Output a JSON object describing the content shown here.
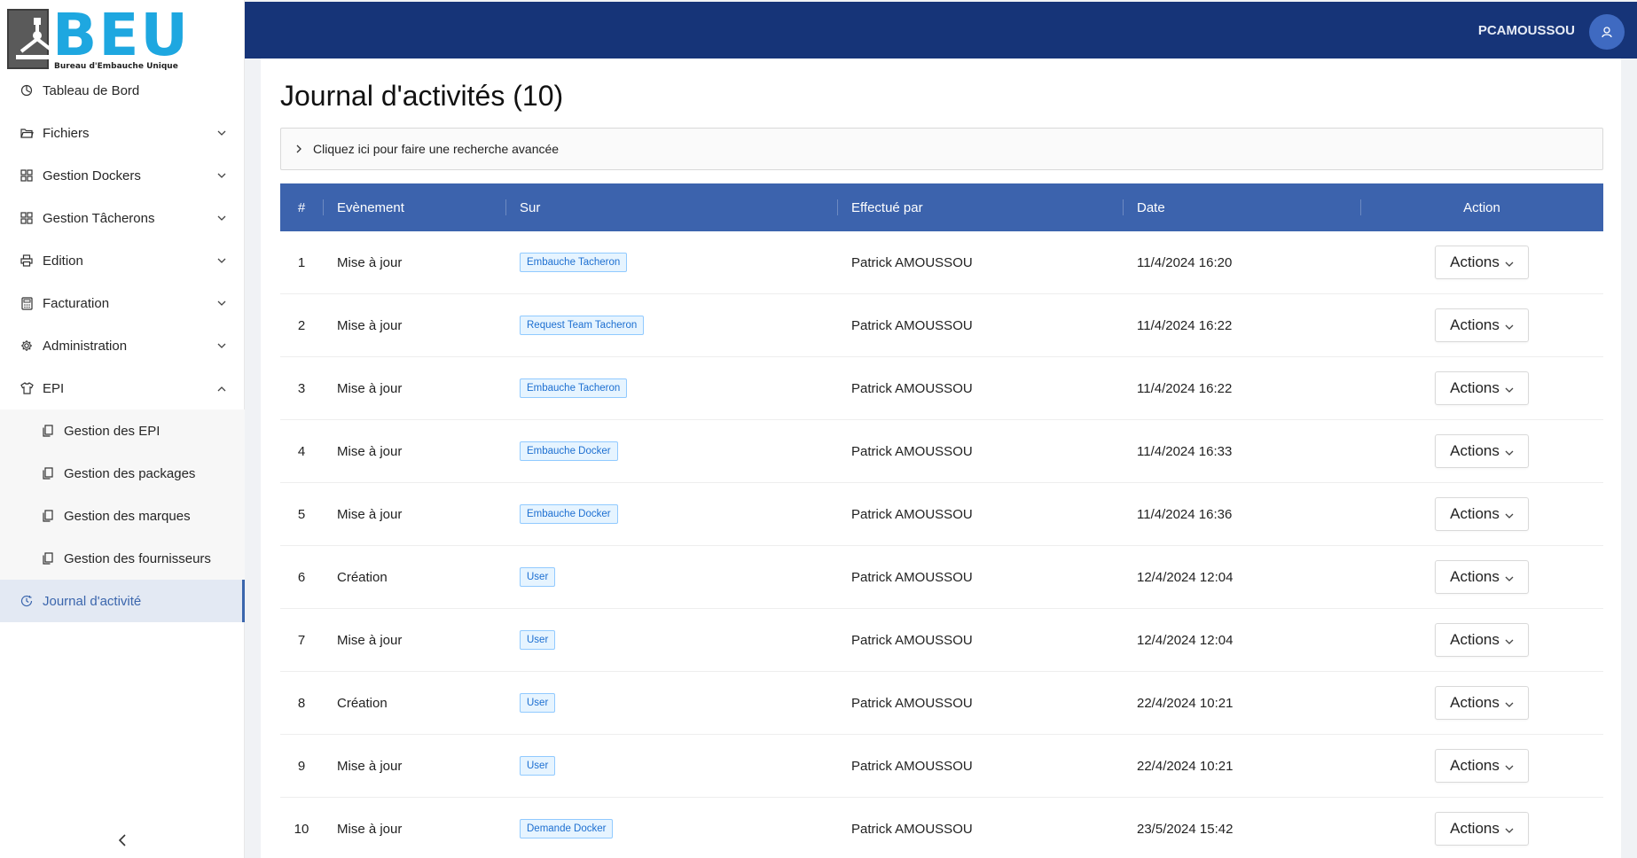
{
  "brand": {
    "logo_text": "BEU",
    "logo_subtitle": "Bureau d'Embauche Unique"
  },
  "sidebar": {
    "items": [
      {
        "label": "Tableau de Bord",
        "icon": "dashboard-icon",
        "has_chevron": false
      },
      {
        "label": "Fichiers",
        "icon": "folder-icon",
        "has_chevron": true
      },
      {
        "label": "Gestion Dockers",
        "icon": "grid-icon",
        "has_chevron": true
      },
      {
        "label": "Gestion Tâcherons",
        "icon": "grid-icon",
        "has_chevron": true
      },
      {
        "label": "Edition",
        "icon": "printer-icon",
        "has_chevron": true
      },
      {
        "label": "Facturation",
        "icon": "calculator-icon",
        "has_chevron": true
      },
      {
        "label": "Administration",
        "icon": "gear-icon",
        "has_chevron": true
      },
      {
        "label": "EPI",
        "icon": "shirt-icon",
        "has_chevron": true,
        "expanded": true
      }
    ],
    "sub_items": [
      {
        "label": "Gestion des EPI",
        "icon": "copy-icon"
      },
      {
        "label": "Gestion des packages",
        "icon": "copy-icon"
      },
      {
        "label": "Gestion des marques",
        "icon": "copy-icon"
      },
      {
        "label": "Gestion des fournisseurs",
        "icon": "copy-icon"
      }
    ],
    "active_item": {
      "label": "Journal d'activité",
      "icon": "clock-icon"
    },
    "collapse_icon": "chevron-left-icon"
  },
  "header": {
    "user_name": "PCAMOUSSOU",
    "avatar_icon": "user-icon"
  },
  "page": {
    "title": "Journal d'activités (10)",
    "advanced_search_label": "Cliquez ici pour faire une recherche avancée"
  },
  "table": {
    "columns": [
      "#",
      "Evènement",
      "Sur",
      "Effectué par",
      "Date",
      "Action"
    ],
    "rows": [
      {
        "num": "1",
        "event": "Mise à jour",
        "on": "Embauche Tacheron",
        "by": "Patrick AMOUSSOU",
        "date": "11/4/2024 16:20",
        "action": "Actions"
      },
      {
        "num": "2",
        "event": "Mise à jour",
        "on": "Request Team Tacheron",
        "by": "Patrick AMOUSSOU",
        "date": "11/4/2024 16:22",
        "action": "Actions"
      },
      {
        "num": "3",
        "event": "Mise à jour",
        "on": "Embauche Tacheron",
        "by": "Patrick AMOUSSOU",
        "date": "11/4/2024 16:22",
        "action": "Actions"
      },
      {
        "num": "4",
        "event": "Mise à jour",
        "on": "Embauche Docker",
        "by": "Patrick AMOUSSOU",
        "date": "11/4/2024 16:33",
        "action": "Actions"
      },
      {
        "num": "5",
        "event": "Mise à jour",
        "on": "Embauche Docker",
        "by": "Patrick AMOUSSOU",
        "date": "11/4/2024 16:36",
        "action": "Actions"
      },
      {
        "num": "6",
        "event": "Création",
        "on": "User",
        "by": "Patrick AMOUSSOU",
        "date": "12/4/2024 12:04",
        "action": "Actions"
      },
      {
        "num": "7",
        "event": "Mise à jour",
        "on": "User",
        "by": "Patrick AMOUSSOU",
        "date": "12/4/2024 12:04",
        "action": "Actions"
      },
      {
        "num": "8",
        "event": "Création",
        "on": "User",
        "by": "Patrick AMOUSSOU",
        "date": "22/4/2024 10:21",
        "action": "Actions"
      },
      {
        "num": "9",
        "event": "Mise à jour",
        "on": "User",
        "by": "Patrick AMOUSSOU",
        "date": "22/4/2024 10:21",
        "action": "Actions"
      },
      {
        "num": "10",
        "event": "Mise à jour",
        "on": "Demande Docker",
        "by": "Patrick AMOUSSOU",
        "date": "23/5/2024 15:42",
        "action": "Actions"
      }
    ]
  },
  "colors": {
    "header_bg": "#163478",
    "table_header_bg": "#3c63ad",
    "accent": "#3b66ad",
    "logo_blue": "#1ea7e0",
    "tag_text": "#1d6fd1"
  }
}
